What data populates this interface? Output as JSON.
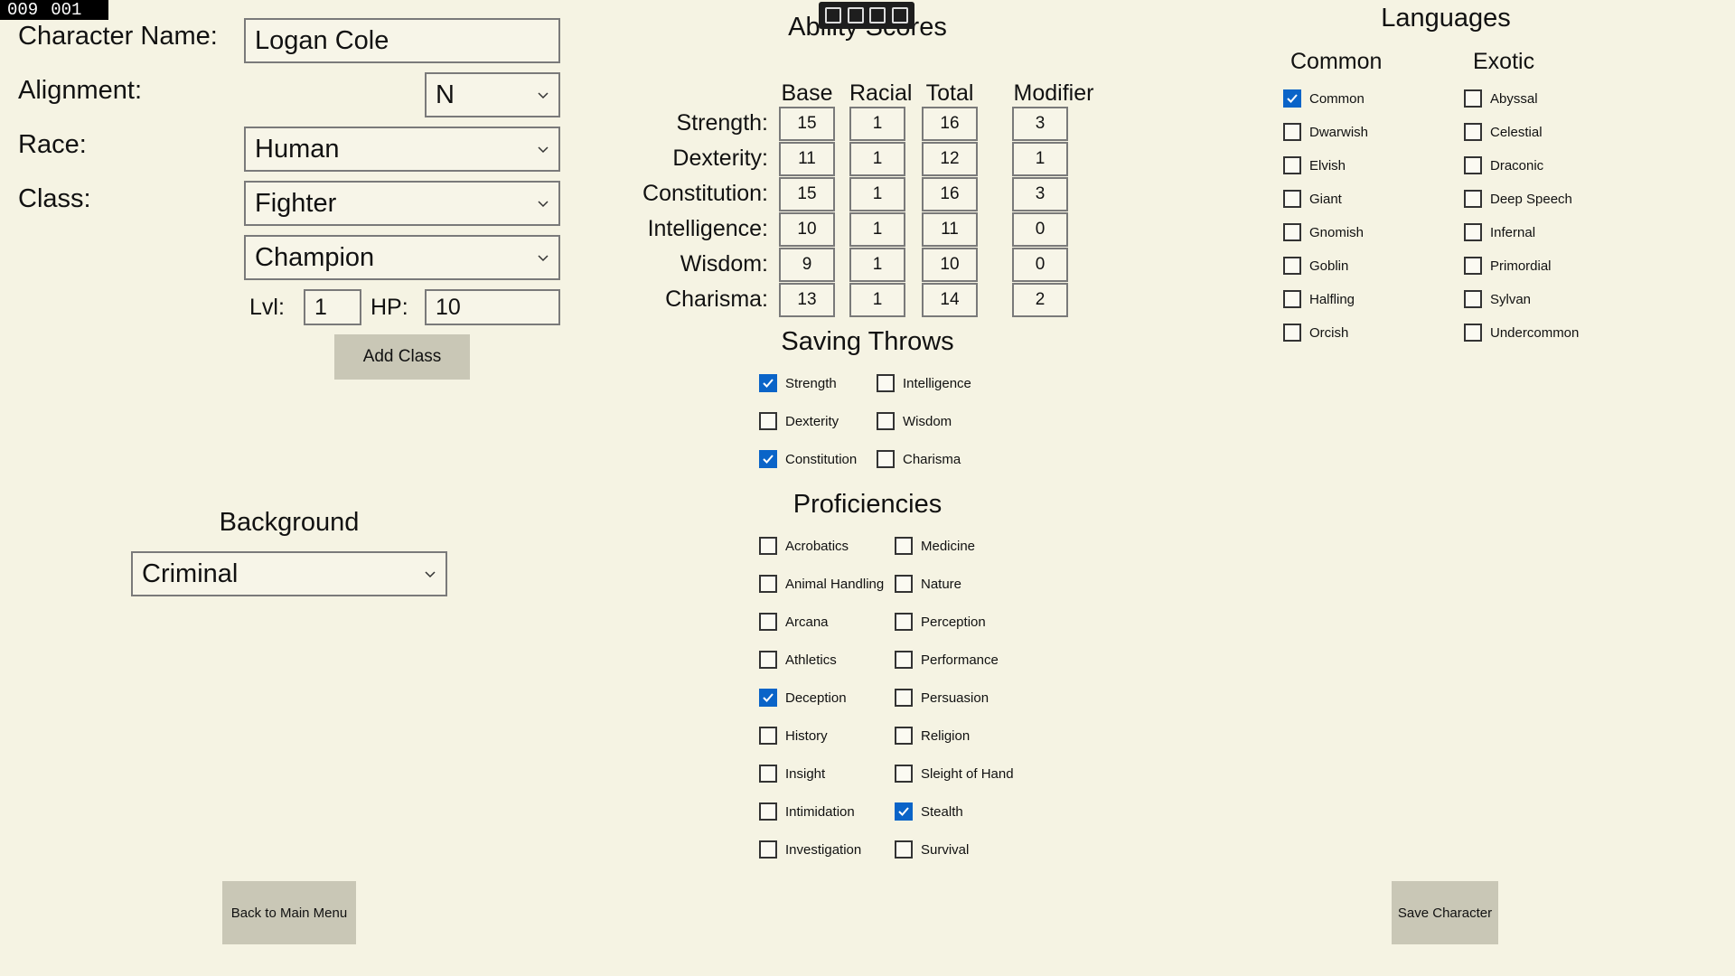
{
  "debug_counter": {
    "a": "009",
    "b": "001"
  },
  "toolbar_icons": [
    "select-icon",
    "pointer-icon",
    "frame-icon",
    "inspect-icon"
  ],
  "character": {
    "name_label": "Character Name:",
    "name_value": "Logan Cole",
    "alignment_label": "Alignment:",
    "alignment_value": "N",
    "race_label": "Race:",
    "race_value": "Human",
    "class_label": "Class:",
    "class_value": "Fighter",
    "subclass_value": "Champion",
    "lvl_label": "Lvl:",
    "lvl_value": "1",
    "hp_label": "HP:",
    "hp_value": "10",
    "add_class_label": "Add Class"
  },
  "background": {
    "title": "Background",
    "value": "Criminal"
  },
  "ability": {
    "title": "Ability Scores",
    "headers": {
      "base": "Base",
      "racial": "Racial",
      "total": "Total",
      "modifier": "Modifier"
    },
    "rows": [
      {
        "label": "Strength:",
        "base": "15",
        "racial": "1",
        "total": "16",
        "mod": "3"
      },
      {
        "label": "Dexterity:",
        "base": "11",
        "racial": "1",
        "total": "12",
        "mod": "1"
      },
      {
        "label": "Constitution:",
        "base": "15",
        "racial": "1",
        "total": "16",
        "mod": "3"
      },
      {
        "label": "Intelligence:",
        "base": "10",
        "racial": "1",
        "total": "11",
        "mod": "0"
      },
      {
        "label": "Wisdom:",
        "base": "9",
        "racial": "1",
        "total": "10",
        "mod": "0"
      },
      {
        "label": "Charisma:",
        "base": "13",
        "racial": "1",
        "total": "14",
        "mod": "2"
      }
    ]
  },
  "saving_throws": {
    "title": "Saving Throws",
    "left": [
      {
        "label": "Strength",
        "checked": true
      },
      {
        "label": "Dexterity",
        "checked": false
      },
      {
        "label": "Constitution",
        "checked": true
      }
    ],
    "right": [
      {
        "label": "Intelligence",
        "checked": false
      },
      {
        "label": "Wisdom",
        "checked": false
      },
      {
        "label": "Charisma",
        "checked": false
      }
    ]
  },
  "proficiencies": {
    "title": "Proficiencies",
    "left": [
      {
        "label": "Acrobatics",
        "checked": false
      },
      {
        "label": "Animal Handling",
        "checked": false
      },
      {
        "label": "Arcana",
        "checked": false
      },
      {
        "label": "Athletics",
        "checked": false
      },
      {
        "label": "Deception",
        "checked": true
      },
      {
        "label": "History",
        "checked": false
      },
      {
        "label": "Insight",
        "checked": false
      },
      {
        "label": "Intimidation",
        "checked": false
      },
      {
        "label": "Investigation",
        "checked": false
      }
    ],
    "right": [
      {
        "label": "Medicine",
        "checked": false
      },
      {
        "label": "Nature",
        "checked": false
      },
      {
        "label": "Perception",
        "checked": false
      },
      {
        "label": "Performance",
        "checked": false
      },
      {
        "label": "Persuasion",
        "checked": false
      },
      {
        "label": "Religion",
        "checked": false
      },
      {
        "label": "Sleight of Hand",
        "checked": false
      },
      {
        "label": "Stealth",
        "checked": true
      },
      {
        "label": "Survival",
        "checked": false
      }
    ]
  },
  "languages": {
    "title": "Languages",
    "common_title": "Common",
    "exotic_title": "Exotic",
    "common": [
      {
        "label": "Common",
        "checked": true
      },
      {
        "label": "Dwarwish",
        "checked": false
      },
      {
        "label": "Elvish",
        "checked": false
      },
      {
        "label": "Giant",
        "checked": false
      },
      {
        "label": "Gnomish",
        "checked": false
      },
      {
        "label": "Goblin",
        "checked": false
      },
      {
        "label": "Halfling",
        "checked": false
      },
      {
        "label": "Orcish",
        "checked": false
      }
    ],
    "exotic": [
      {
        "label": "Abyssal",
        "checked": false
      },
      {
        "label": "Celestial",
        "checked": false
      },
      {
        "label": "Draconic",
        "checked": false
      },
      {
        "label": "Deep Speech",
        "checked": false
      },
      {
        "label": "Infernal",
        "checked": false
      },
      {
        "label": "Primordial",
        "checked": false
      },
      {
        "label": "Sylvan",
        "checked": false
      },
      {
        "label": "Undercommon",
        "checked": false
      }
    ]
  },
  "footer": {
    "back_label": "Back to Main Menu",
    "save_label": "Save Character"
  },
  "colors": {
    "accent": "#0a64c8",
    "background": "#f5f3e3",
    "button": "#c9c7b6"
  }
}
